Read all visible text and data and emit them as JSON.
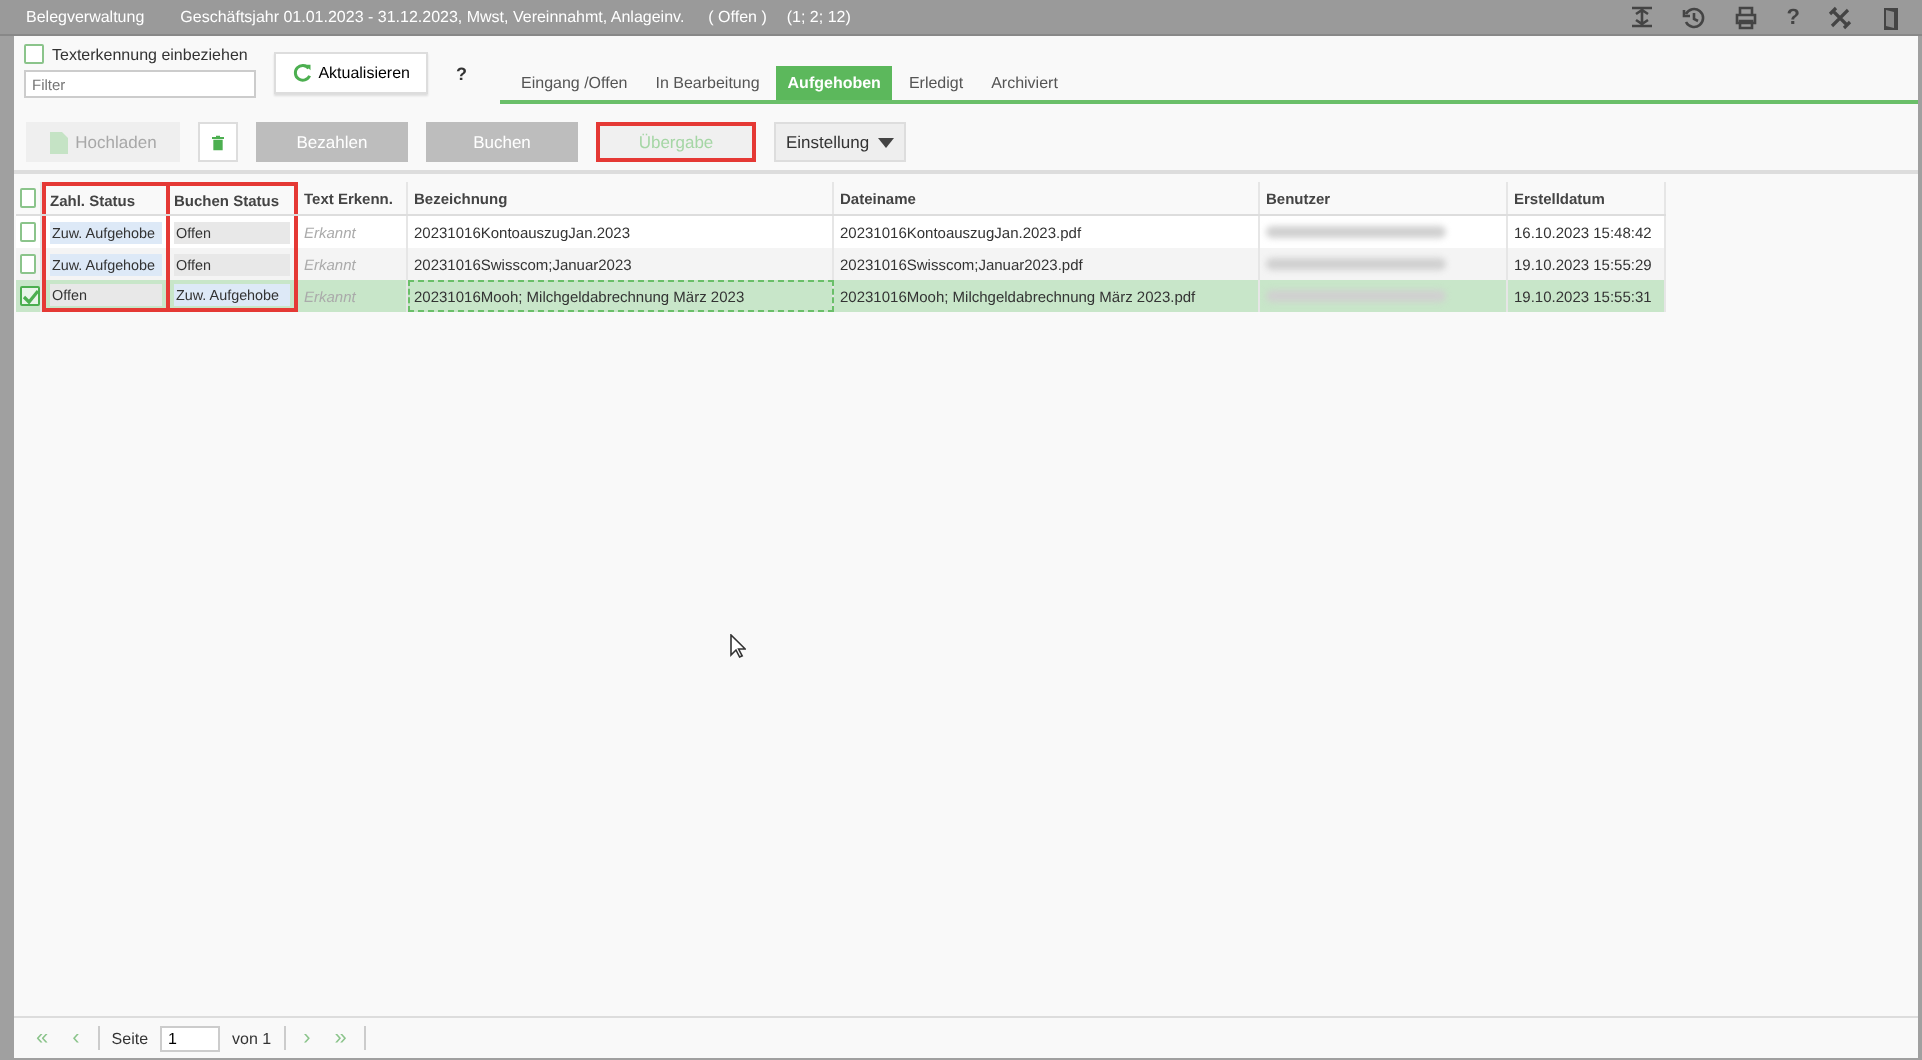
{
  "window": {
    "title": "Belegverwaltung",
    "subtitle": "Geschäftsjahr 01.01.2023 - 31.12.2023, Mwst, Vereinnahmt, Anlageinv.",
    "status": "( Offen )",
    "numbers": "(1; 2; 12)",
    "help_icon": "?"
  },
  "filter": {
    "checkbox_label": "Texterkennung einbeziehen",
    "checked": false,
    "placeholder": "Filter"
  },
  "refresh_button": "Aktualisieren",
  "help": "?",
  "tabs": [
    {
      "label": "Eingang /Offen",
      "selected": false
    },
    {
      "label": "In Bearbeitung",
      "selected": false
    },
    {
      "label": "Aufgehoben",
      "selected": true
    },
    {
      "label": "Erledigt",
      "selected": false
    },
    {
      "label": "Archiviert",
      "selected": false
    }
  ],
  "toolbar": [
    {
      "kind": "upload",
      "label": "Hochladen",
      "disabled": true,
      "highlighted": false
    },
    {
      "kind": "delete",
      "disabled": false,
      "highlighted": false
    },
    {
      "kind": "action",
      "label": "Bezahlen",
      "disabled": true,
      "highlighted": false
    },
    {
      "kind": "action",
      "label": "Buchen",
      "disabled": true,
      "highlighted": false
    },
    {
      "kind": "light",
      "label": "Übergabe",
      "disabled": true,
      "highlighted": true
    },
    {
      "kind": "dropdown",
      "label": "Einstellung",
      "disabled": false,
      "highlighted": false
    }
  ],
  "table": {
    "all_checked": false,
    "columns": [
      {
        "label": "Zahl. Status",
        "highlighted": true
      },
      {
        "label": "Buchen Status",
        "highlighted": true
      },
      {
        "label": "Text Erkenn.",
        "highlighted": false
      },
      {
        "label": "Bezeichnung",
        "highlighted": false
      },
      {
        "label": "Dateiname",
        "highlighted": false
      },
      {
        "label": "Benutzer",
        "highlighted": false
      },
      {
        "label": "Erstelldatum",
        "highlighted": false
      }
    ],
    "rows": [
      {
        "selected": false,
        "checked": false,
        "zahl_status": {
          "text": "Zuw. Aufgehobe",
          "kind": "cancelled"
        },
        "buchen_status": {
          "text": "Offen",
          "kind": "open"
        },
        "text_erkenn": "Erkannt",
        "bezeichnung": "20231016KontoauszugJan.2023",
        "dateiname": "20231016KontoauszugJan.2023.pdf",
        "erstelldatum": "16.10.2023 15:48:42"
      },
      {
        "selected": false,
        "checked": false,
        "zahl_status": {
          "text": "Zuw. Aufgehobe",
          "kind": "cancelled"
        },
        "buchen_status": {
          "text": "Offen",
          "kind": "open"
        },
        "text_erkenn": "Erkannt",
        "bezeichnung": "20231016Swisscom;Januar2023",
        "dateiname": "20231016Swisscom;Januar2023.pdf",
        "erstelldatum": "19.10.2023 15:55:29"
      },
      {
        "selected": true,
        "checked": true,
        "zahl_status": {
          "text": "Offen",
          "kind": "open"
        },
        "buchen_status": {
          "text": "Zuw. Aufgehobe",
          "kind": "cancelled"
        },
        "text_erkenn": "Erkannt",
        "bezeichnung": "20231016Mooh; Milchgeldabrechnung März 2023",
        "dateiname": "20231016Mooh; Milchgeldabrechnung März 2023.pdf",
        "erstelldatum": "19.10.2023 15:55:31"
      }
    ]
  },
  "pager": {
    "first": "«",
    "prev": "‹",
    "page_label": "Seite",
    "page": "1",
    "of": "von 1",
    "next": "›",
    "last": "»"
  }
}
